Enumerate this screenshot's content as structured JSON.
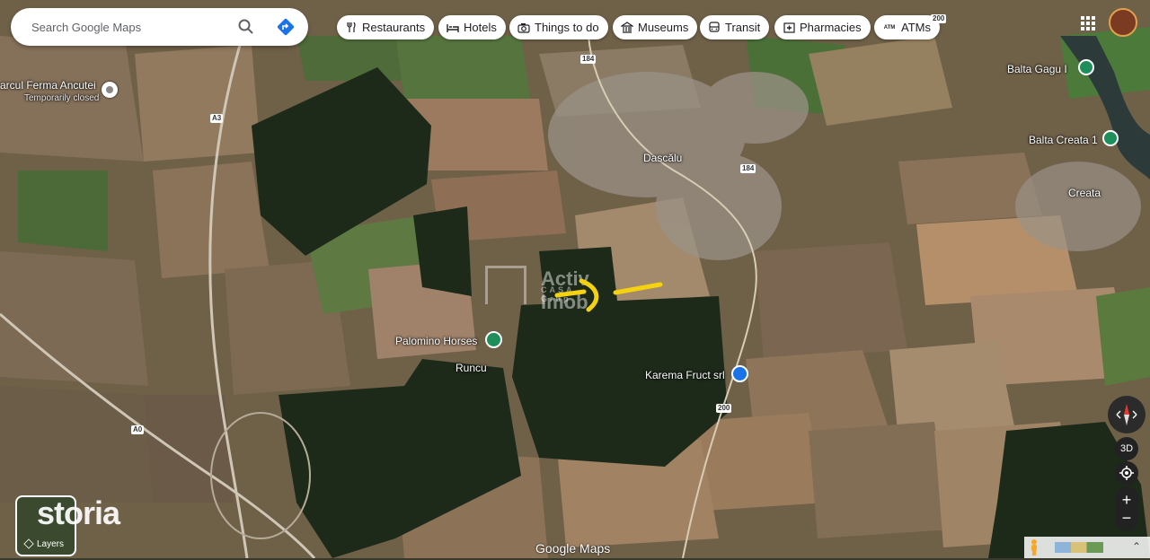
{
  "search": {
    "placeholder": "Search Google Maps"
  },
  "chips": [
    {
      "label": "Restaurants",
      "icon": "fork-knife-icon"
    },
    {
      "label": "Hotels",
      "icon": "bed-icon"
    },
    {
      "label": "Things to do",
      "icon": "camera-icon"
    },
    {
      "label": "Museums",
      "icon": "museum-icon"
    },
    {
      "label": "Transit",
      "icon": "bus-icon"
    },
    {
      "label": "Pharmacies",
      "icon": "pharmacy-icon"
    },
    {
      "label": "ATMs",
      "icon": "atm-icon"
    }
  ],
  "places": {
    "parcul_name": "arcul Ferma Ancutei",
    "parcul_status": "Temporarily closed",
    "dascalu": "Dascălu",
    "balta_gagu": "Balta Gagu I",
    "balta_creata": "Balta Creata 1",
    "creata": "Creata",
    "palomino": "Palomino Horses",
    "runcu": "Runcu",
    "karema": "Karema Fruct srl"
  },
  "roads": {
    "a3": "A3",
    "a0": "A0",
    "r184_top": "184",
    "r184_mid": "184",
    "r200": "200",
    "r200_top": "200"
  },
  "watermarks": {
    "activ_line1": "Activ Imob",
    "activ_line2": "CASA Grup",
    "storia": "storia"
  },
  "controls": {
    "view_3d": "3D",
    "zoom_in": "+",
    "zoom_out": "−",
    "layers": "Layers",
    "expand": "⌃"
  },
  "attribution": "Google Maps",
  "colors": {
    "forest": "#1d2a1a",
    "field_brown": "#8a7258",
    "field_green": "#4f6a3a",
    "route_yellow": "#f4d20f",
    "place_green": "#1e8e5a",
    "place_blue": "#1a73e8"
  }
}
